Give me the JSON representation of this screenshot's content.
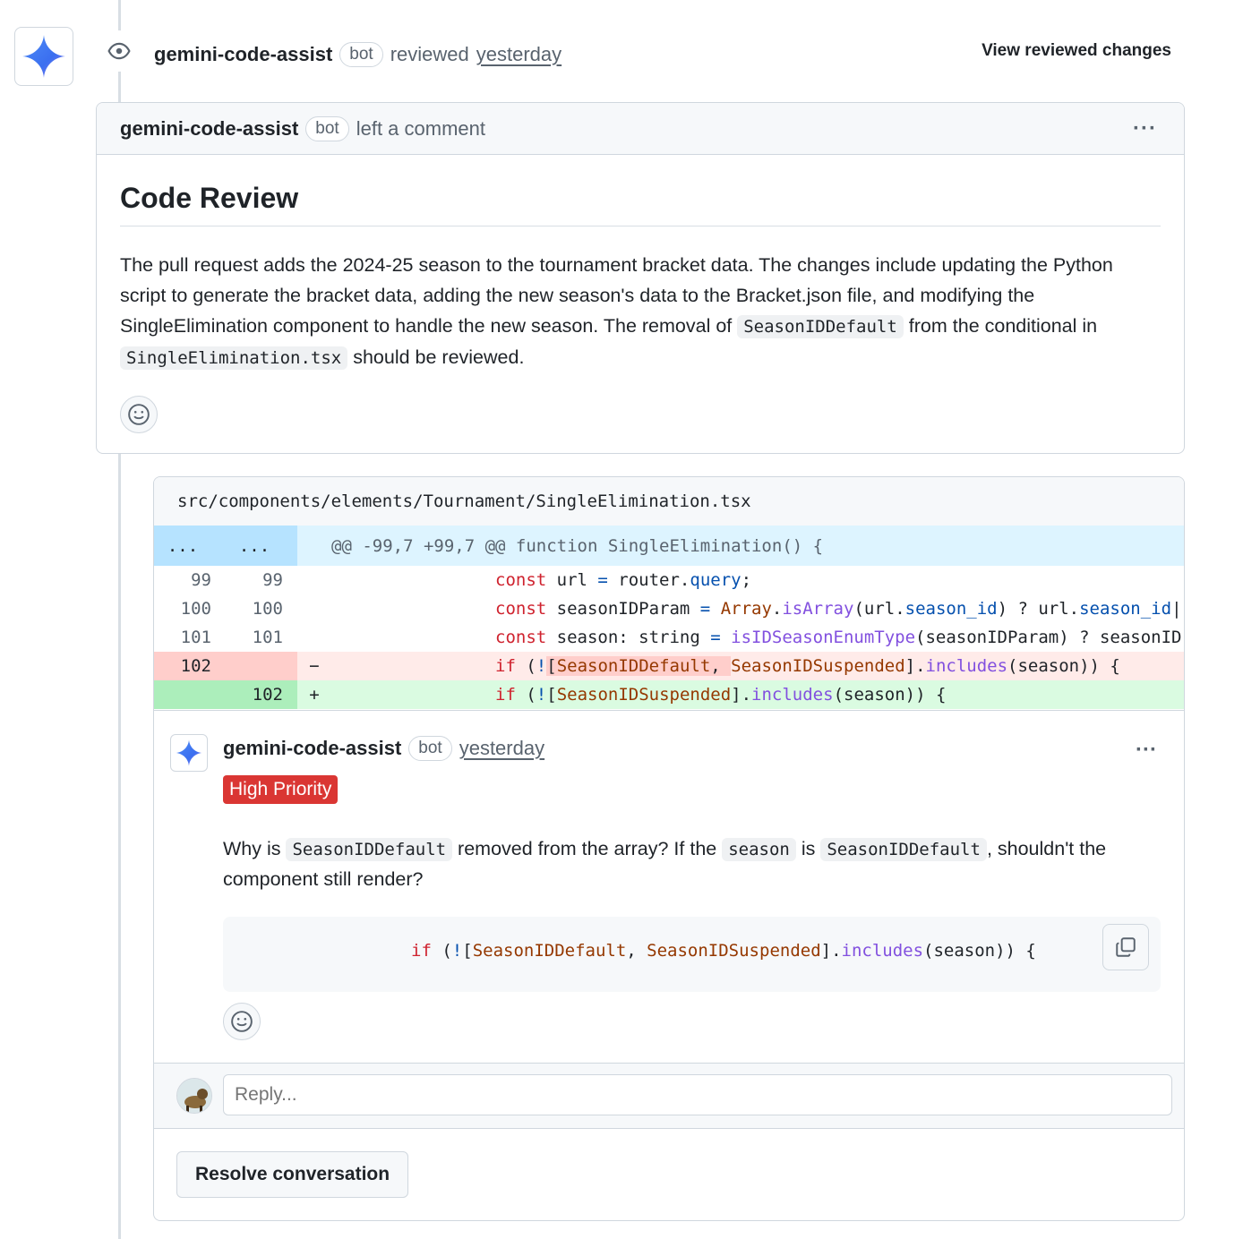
{
  "review": {
    "author": "gemini-code-assist",
    "bot_label": "bot",
    "action": "reviewed",
    "time": "yesterday",
    "view_changes": "View reviewed changes"
  },
  "summary_comment": {
    "author": "gemini-code-assist",
    "bot_label": "bot",
    "action": "left a comment",
    "menu": "···",
    "title": "Code Review",
    "text_1": "The pull request adds the 2024-25 season to the tournament bracket data. The changes include updating the Python script to generate the bracket data, adding the new season's data to the Bracket.json file, and modifying the SingleElimination component to handle the new season. The removal of ",
    "code_1": "SeasonIDDefault",
    "text_2": " from the conditional in ",
    "code_2": "SingleElimination.tsx",
    "text_3": " should be reviewed."
  },
  "diff": {
    "file_path": "src/components/elements/Tournament/SingleElimination.tsx",
    "hunk": {
      "left": "...",
      "right": "...",
      "header": "@@ -99,7 +99,7 @@ function SingleElimination() {"
    },
    "lines": [
      {
        "old": "99",
        "new": "99",
        "sign": ""
      },
      {
        "old": "100",
        "new": "100",
        "sign": ""
      },
      {
        "old": "101",
        "new": "101",
        "sign": ""
      },
      {
        "old": "102",
        "new": "",
        "sign": "−"
      },
      {
        "old": "",
        "new": "102",
        "sign": "+"
      }
    ],
    "tokens": {
      "const": "const",
      "url": " url ",
      "eq": "=",
      "router": " router.",
      "query": "query",
      "semi": ";",
      "seasonIDParam": " seasonIDParam ",
      "array": "Array",
      "dot": ".",
      "isArray": "isArray",
      "urlsid_open": "(url.",
      "season_id": "season_id",
      "ternary": ") ? url.",
      "season_id2": "season_id",
      "pipe": "|",
      "season_decl": " season: string ",
      "isIDSeasonEnumType": "isIDSeasonEnumType",
      "paramTernary": "(seasonIDParam) ? seasonID",
      "if": "if",
      "open_paren": " (",
      "bang": "!",
      "bracket_open": "[",
      "SeasonIDDefault": "SeasonIDDefault",
      "comma": ", ",
      "SeasonIDSuspended": "SeasonIDSuspended",
      "bracket_close": "].",
      "includes": "includes",
      "call_end": "(season)) {"
    }
  },
  "inline_comment": {
    "author": "gemini-code-assist",
    "bot_label": "bot",
    "time": "yesterday",
    "menu": "···",
    "priority": "High Priority",
    "text_1": "Why is ",
    "code_1": "SeasonIDDefault",
    "text_2": " removed from the array? If the ",
    "code_2": "season",
    "text_3": " is ",
    "code_3": "SeasonIDDefault",
    "text_4": ", shouldn't the component still render?"
  },
  "reply": {
    "placeholder": "Reply..."
  },
  "resolve_label": "Resolve conversation",
  "colors": {
    "priority_red": "#da3633",
    "add_bg": "#dafbe1",
    "del_bg": "#ffebe9",
    "hunk_bg": "#ddf4ff"
  },
  "icons": {
    "avatar": "gemini-sparkle-icon",
    "review": "eye-icon",
    "emoji": "smiley-icon",
    "copy": "copy-icon"
  }
}
